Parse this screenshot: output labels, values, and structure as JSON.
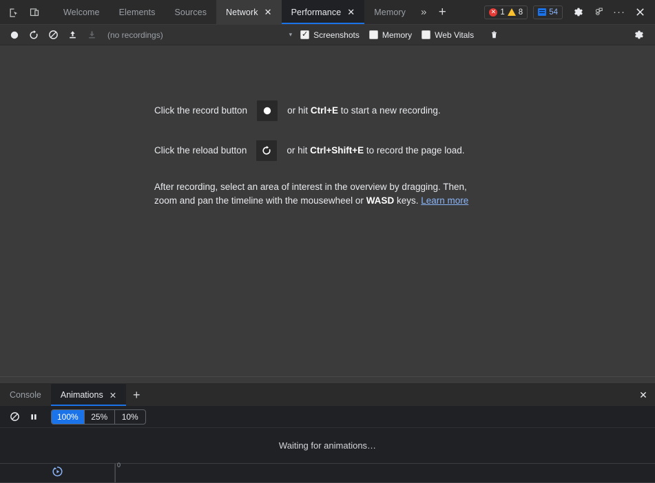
{
  "top_tabbar": {
    "icons": [
      {
        "name": "inspect-element-icon",
        "label": "Inspect element"
      },
      {
        "name": "device-toolbar-icon",
        "label": "Toggle device toolbar"
      }
    ],
    "tabs": [
      {
        "label": "Welcome",
        "state": "inactive",
        "closable": false
      },
      {
        "label": "Elements",
        "state": "inactive",
        "closable": false
      },
      {
        "label": "Sources",
        "state": "inactive",
        "closable": false
      },
      {
        "label": "Network",
        "state": "hovered",
        "closable": true
      },
      {
        "label": "Performance",
        "state": "active",
        "closable": true
      },
      {
        "label": "Memory",
        "state": "inactive",
        "closable": false
      }
    ],
    "more_tabs_label": "»",
    "add_tab_label": "+",
    "close_glyph": "✕",
    "badges": {
      "errors": "1",
      "warnings": "8",
      "messages": "54"
    },
    "right_icons": [
      {
        "name": "settings-gear-icon",
        "label": "Settings"
      },
      {
        "name": "feedback-icon",
        "label": "Feedback"
      },
      {
        "name": "more-options-icon",
        "label": "···"
      },
      {
        "name": "close-devtools-icon",
        "label": "✕"
      }
    ]
  },
  "perf_toolbar": {
    "record_label": "Record",
    "reload_record_label": "Record and reload",
    "clear_label": "Clear",
    "upload_label": "Load profile",
    "download_label": "Save profile",
    "recordings_text": "(no recordings)",
    "caret_glyph": "▾",
    "checkboxes": [
      {
        "label": "Screenshots",
        "checked": true
      },
      {
        "label": "Memory",
        "checked": false
      },
      {
        "label": "Web Vitals",
        "checked": false
      }
    ],
    "trash_label": "Clear",
    "settings_label": "Capture settings"
  },
  "landing": {
    "row1": {
      "prefix": "Click the record button",
      "suffix_before_keys": "or hit",
      "key1": "Ctrl",
      "plus": "+",
      "key2": "E",
      "suffix_after_keys": "to start a new recording."
    },
    "row2": {
      "prefix": "Click the reload button",
      "suffix_before_keys": "or hit",
      "key1": "Ctrl",
      "plus": "+",
      "key2": "Shift",
      "plus2": "+",
      "key3": "E",
      "suffix_after_keys": "to record the page load."
    },
    "paragraph_line1": "After recording, select an area of interest in the overview by dragging. Then,",
    "paragraph_line2a": "zoom and pan the timeline with the mousewheel or",
    "paragraph_key": "WASD",
    "paragraph_line2b": "keys.",
    "learn_more": "Learn more"
  },
  "drawer": {
    "tabs": [
      {
        "label": "Console",
        "state": "inactive",
        "closable": false
      },
      {
        "label": "Animations",
        "state": "active",
        "closable": true
      }
    ],
    "close_glyph": "✕",
    "add_tab_label": "+",
    "close_drawer_label": "✕",
    "animations": {
      "clear_label": "Clear all",
      "pause_label": "Pause all",
      "speeds": [
        {
          "label": "100%",
          "active": true
        },
        {
          "label": "25%",
          "active": false
        },
        {
          "label": "10%",
          "active": false
        }
      ],
      "empty_message": "Waiting for animations…",
      "timeline_tick_label": "0",
      "scrubber_label": "Replay timeline"
    }
  }
}
